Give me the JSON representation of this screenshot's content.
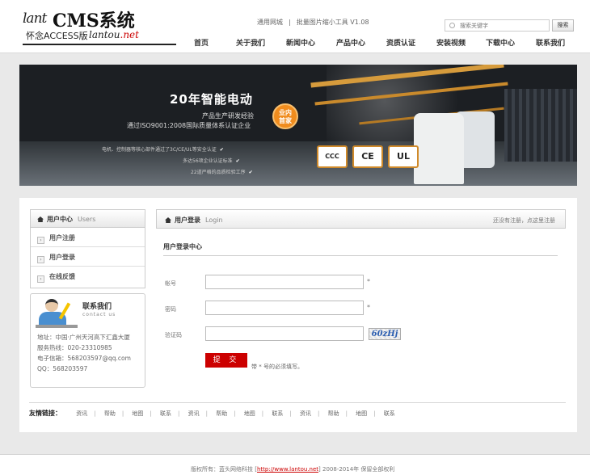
{
  "logo": {
    "script": "lant",
    "brand": "CMS系统",
    "edition": "怀念ACCESS版",
    "domain_prefix": "lantou",
    "domain_suffix": ".net"
  },
  "toplinks": [
    {
      "label": "通用网城"
    },
    {
      "label": "批量图片缩小工具 V1.08"
    }
  ],
  "search": {
    "placeholder": "搜索关键字",
    "button": "搜索"
  },
  "nav": [
    "首页",
    "关于我们",
    "新闻中心",
    "产品中心",
    "资质认证",
    "安装视频",
    "下载中心",
    "联系我们"
  ],
  "banner": {
    "title": "20年智能电动",
    "sub1": "产品生产研发经验",
    "sub2": "通过ISO9001:2008国际质量体系认证企业",
    "badge_line1": "业内",
    "badge_line2": "首家",
    "points": [
      "电机、控制器等核心部件通过了3C/CE/UL等安全认证",
      "多达56项企业认证标准",
      "22道严格的品质检验工序"
    ],
    "certs": [
      "CCC",
      "CE",
      "UL"
    ]
  },
  "sidebar": {
    "title": "用户中心",
    "title_en": "Users",
    "items": [
      {
        "label": "用户注册"
      },
      {
        "label": "用户登录"
      },
      {
        "label": "在线反馈"
      }
    ]
  },
  "contact": {
    "title": "联系我们",
    "title_en": "contact us",
    "lines": [
      "地址：中国·广州天河高下汇鑫大厦",
      "服务热线：020-23310985",
      "电子信箱：568203597@qq.com",
      "QQ：568203597"
    ]
  },
  "main": {
    "title": "用户登录",
    "title_en": "Login",
    "register_hint": "还没有注册，点这里注册",
    "section_title": "用户登录中心",
    "fields": [
      {
        "label": "帐号",
        "value": "",
        "star": "*"
      },
      {
        "label": "密码",
        "value": "",
        "star": "*"
      },
      {
        "label": "验证码",
        "value": ""
      }
    ],
    "captcha": "60zHj",
    "submit": "提 交",
    "required_note": "带 * 号的必须填写。"
  },
  "friend_links": {
    "label": "友情链接：",
    "items": [
      "资讯",
      "帮助",
      "地图",
      "联系",
      "资讯",
      "帮助",
      "地图",
      "联系",
      "资讯",
      "帮助",
      "地图",
      "联系"
    ]
  },
  "footer": {
    "prefix": "版权所有：蓝头网络科技 [",
    "url": "http://www.lantou.net",
    "suffix": "] 2008-2014年 保留全部权利"
  }
}
